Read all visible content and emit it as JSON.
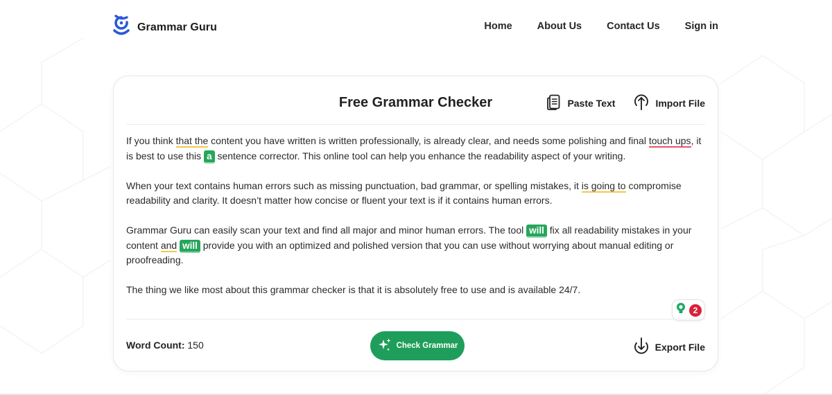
{
  "brand": {
    "name": "Grammar Guru",
    "logo_icon": "grammar-guru-logo",
    "accent": "#2b58d8"
  },
  "nav": {
    "items": [
      {
        "label": "Home"
      },
      {
        "label": "About Us"
      },
      {
        "label": "Contact Us"
      },
      {
        "label": "Sign in"
      }
    ]
  },
  "checker": {
    "title": "Free Grammar Checker",
    "paste_label": "Paste Text",
    "paste_icon": "clipboard-icon",
    "import_label": "Import File",
    "import_icon": "upload-icon",
    "paragraphs": {
      "p1": {
        "t1": "If you think ",
        "h1": "that the",
        "t2": " content you have written is written professionally, is already clear, and needs some polishing and final ",
        "h2": "touch ups",
        "t3": ", it is best to use this ",
        "chip": "a",
        "t4": " sentence corrector. This online tool can help you enhance the readability aspect of your writing."
      },
      "p2": {
        "t1": "When your text contains human errors such as missing punctuation, bad grammar, or spelling mistakes, it ",
        "h1": "is going to",
        "t2": " compromise readability and clarity. It doesn’t matter how concise or fluent your text is if it contains human errors."
      },
      "p3": {
        "t1": "Grammar Guru can easily scan your text and find all major and minor human errors. The tool ",
        "chip1": "will",
        "t2": " fix all readability mistakes in your content ",
        "h1": "and",
        "t3": " ",
        "chip2": "will",
        "t4": " provide you with an optimized and polished version that you can use without worrying about manual editing or proofreading."
      },
      "p4": {
        "t1": "The thing we like most about this grammar checker is that it is absolutely free to use and is available 24/7."
      }
    },
    "suggestion_count": "2",
    "suggestion_icon": "lightbulb-icon",
    "word_count_label": "Word Count:",
    "word_count_value": "150",
    "check_label": "Check Grammar",
    "check_icon": "sparkle-icon",
    "export_label": "Export File",
    "export_icon": "download-icon",
    "colors": {
      "primary_button": "#1e9e5a",
      "correction_chip": "#26a65b",
      "underline_warning": "#f1c84b",
      "underline_error": "#e7526b",
      "badge": "#d9213a"
    }
  }
}
